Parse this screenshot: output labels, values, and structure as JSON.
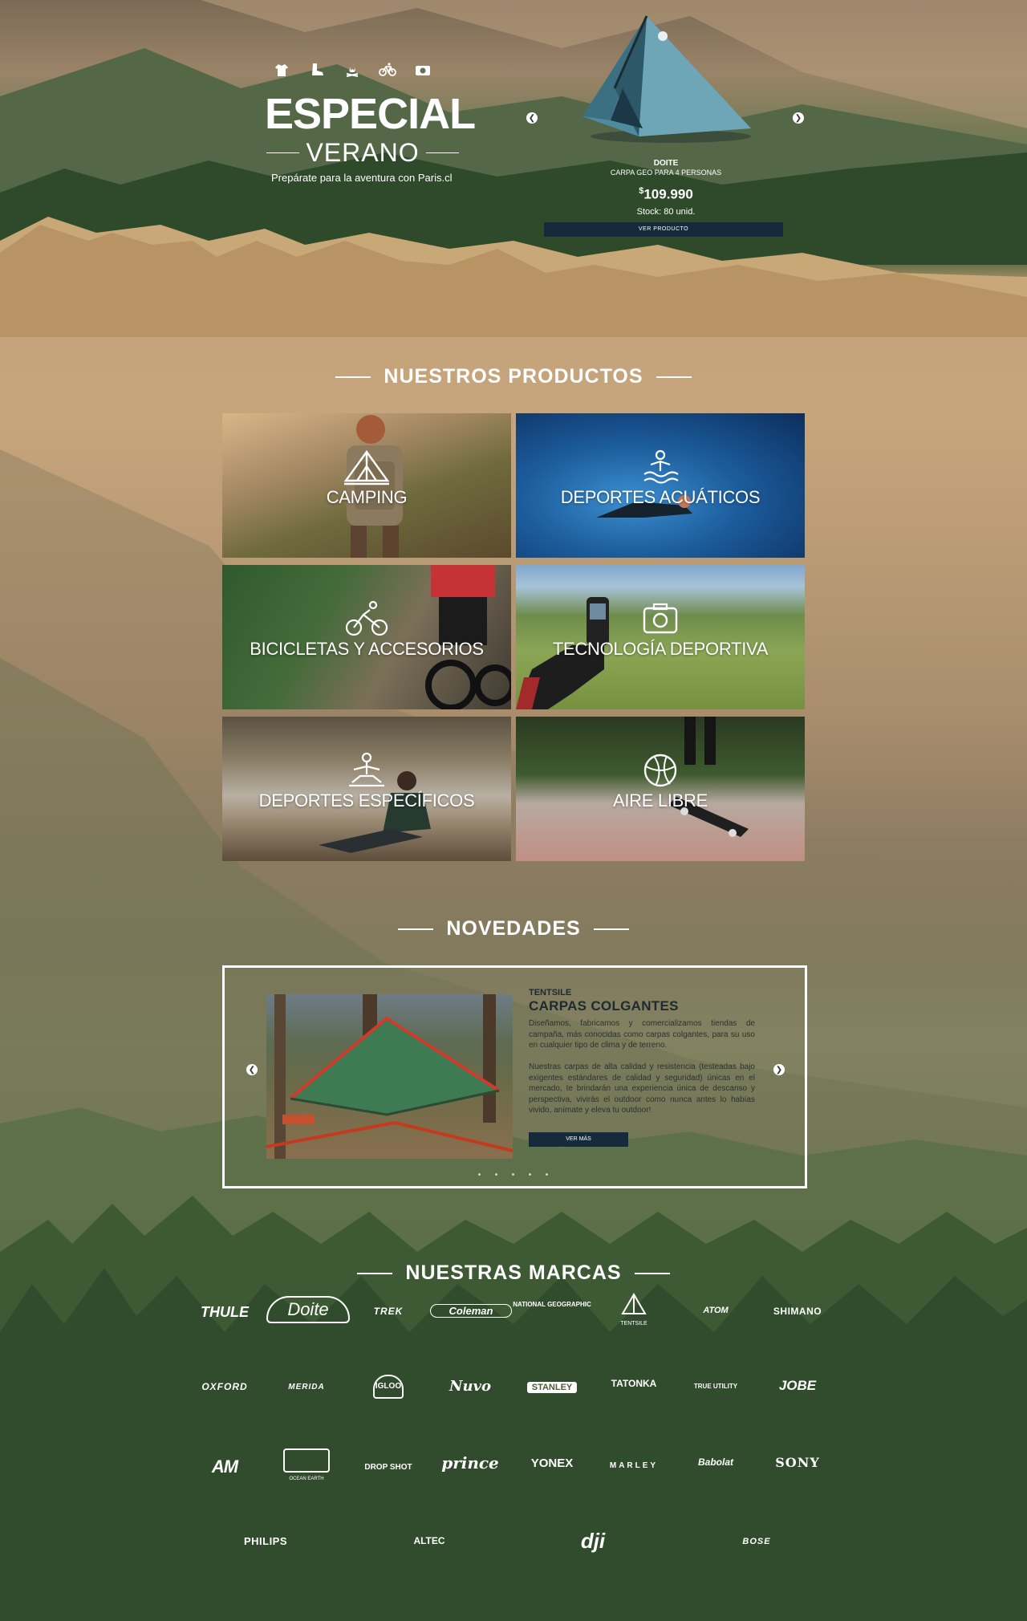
{
  "hero": {
    "icons": [
      "jacket-icon",
      "boot-icon",
      "campfire-icon",
      "bicycle-icon",
      "camera-icon"
    ],
    "title": "ESPECIAL",
    "subtitle": "VERANO",
    "tagline": "Prepárate para la aventura con Paris.cl",
    "product": {
      "brand": "DOITE",
      "name": "CARPA GEO PARA 4 PERSONAS",
      "currency": "$",
      "price": "109.990",
      "stock": "Stock: 80 unid.",
      "button": "VER PRODUCTO"
    }
  },
  "products": {
    "title": "NUESTROS PRODUCTOS",
    "items": [
      {
        "label": "CAMPING",
        "icon": "tent-icon"
      },
      {
        "label": "DEPORTES ACUÁTICOS",
        "icon": "swimmer-icon"
      },
      {
        "label": "BICICLETAS Y ACCESORIOS",
        "icon": "cyclist-icon"
      },
      {
        "label": "TECNOLOGÍA DEPORTIVA",
        "icon": "camera-icon"
      },
      {
        "label": "DEPORTES ESPECÍFICOS",
        "icon": "yoga-icon"
      },
      {
        "label": "AIRE LIBRE",
        "icon": "ball-icon"
      }
    ]
  },
  "novedades": {
    "title": "NOVEDADES",
    "brand": "TENTSILE",
    "heading": "CARPAS COLGANTES",
    "p1": "Diseñamos, fabricamos y comercializamos tiendas de campaña, más conocidas como carpas colgantes, para su uso en cualquier tipo de clima y de terreno.",
    "p2": "Nuestras carpas de alta calidad y resistencia (testeadas bajo exigentes estándares de calidad y seguridad) únicas en el mercado, te brindarán una experiencia única de descanso y perspectiva, vivirás el outdoor como nunca antes lo habías vivido, anímate y eleva tu outdoor!",
    "button": "VER MÁS"
  },
  "brands": {
    "title": "NUESTRAS MARCAS",
    "row1": [
      "THULE",
      "Doite",
      "TREK",
      "Coleman",
      "NATIONAL GEOGRAPHIC",
      "TENTSILE",
      "ATOM",
      "SHIMANO"
    ],
    "row2": [
      "OXFORD",
      "MERIDA",
      "IGLOO",
      "Nuvo",
      "STANLEY",
      "TATONKA",
      "TRUE UTILITY",
      "JOBE"
    ],
    "row3": [
      "AM",
      "OCEAN EARTH",
      "DROP SHOT",
      "prince",
      "YONEX",
      "MARLEY",
      "Babolat",
      "SONY"
    ],
    "row4": [
      "PHILIPS",
      "ALTEC",
      "dji",
      "BOSE"
    ]
  }
}
